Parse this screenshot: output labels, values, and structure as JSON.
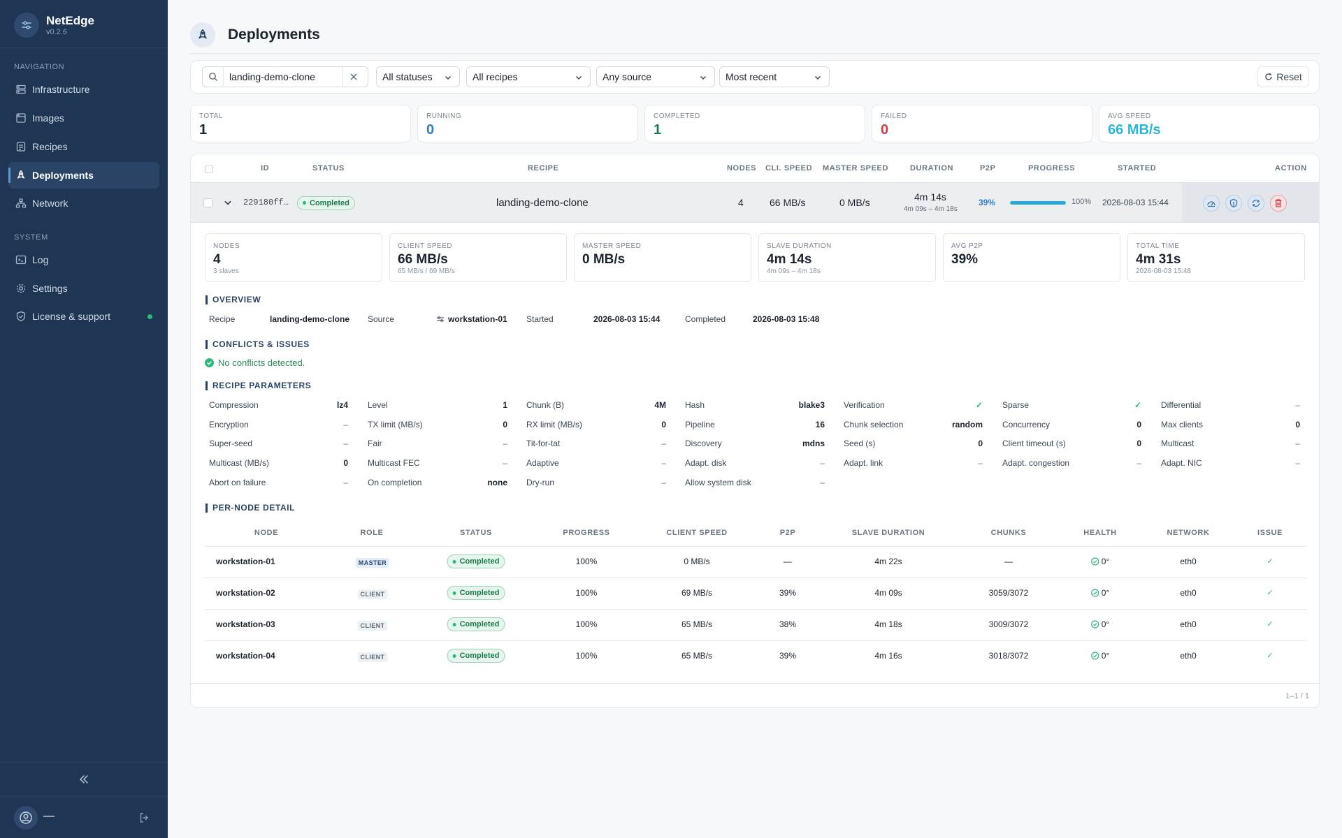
{
  "app": {
    "name": "NetEdge",
    "version": "v0.2.6"
  },
  "sidebar": {
    "sections": {
      "navigation": "NAVIGATION",
      "system": "SYSTEM"
    },
    "nav": [
      {
        "label": "Infrastructure",
        "icon": "server-icon"
      },
      {
        "label": "Images",
        "icon": "disk-icon"
      },
      {
        "label": "Recipes",
        "icon": "recipe-icon"
      },
      {
        "label": "Deployments",
        "icon": "rocket-icon",
        "active": true
      },
      {
        "label": "Network",
        "icon": "network-icon"
      }
    ],
    "system": [
      {
        "label": "Log",
        "icon": "terminal-icon"
      },
      {
        "label": "Settings",
        "icon": "gear-icon"
      },
      {
        "label": "License & support",
        "icon": "shield-icon",
        "status_dot": "#2fb67c"
      }
    ],
    "user": {
      "name": "—"
    }
  },
  "page": {
    "title": "Deployments"
  },
  "filters": {
    "search_value": "landing-demo-clone",
    "status": "All statuses",
    "recipe": "All recipes",
    "source": "Any source",
    "sort": "Most recent",
    "reset_label": "Reset"
  },
  "stats": [
    {
      "label": "TOTAL",
      "value": "1",
      "color": "#1c2430"
    },
    {
      "label": "RUNNING",
      "value": "0",
      "color": "#2f7fc4"
    },
    {
      "label": "COMPLETED",
      "value": "1",
      "color": "#1d7a4b"
    },
    {
      "label": "FAILED",
      "value": "0",
      "color": "#d33a47"
    },
    {
      "label": "AVG SPEED",
      "value": "66 MB/s",
      "color": "#2ab6d8"
    }
  ],
  "table": {
    "headers": {
      "id": "ID",
      "status": "STATUS",
      "recipe": "RECIPE",
      "nodes": "NODES",
      "cli_speed": "CLI. SPEED",
      "master_speed": "MASTER SPEED",
      "duration": "DURATION",
      "p2p": "P2P",
      "progress": "PROGRESS",
      "started": "STARTED",
      "action": "ACTION"
    },
    "row": {
      "id": "229180ff…",
      "status": "Completed",
      "recipe": "landing-demo-clone",
      "nodes": "4",
      "cli_speed": "66 MB/s",
      "master_speed": "0 MB/s",
      "duration": "4m 14s",
      "duration_range": "4m 09s – 4m 18s",
      "p2p": "39%",
      "progress_label": "100%",
      "progress_fraction": 1.0,
      "started": "2026-08-03 15:44"
    }
  },
  "detail": {
    "cards": [
      {
        "label": "NODES",
        "value": "4",
        "sub": "3 slaves"
      },
      {
        "label": "CLIENT SPEED",
        "value": "66 MB/s",
        "sub": "65 MB/s / 69 MB/s"
      },
      {
        "label": "MASTER SPEED",
        "value": "0 MB/s",
        "sub": ""
      },
      {
        "label": "SLAVE DURATION",
        "value": "4m 14s",
        "sub": "4m 09s – 4m 18s"
      },
      {
        "label": "AVG P2P",
        "value": "39%",
        "sub": ""
      },
      {
        "label": "TOTAL TIME",
        "value": "4m 31s",
        "sub": "2026-08-03 15:48"
      }
    ],
    "overview_title": "OVERVIEW",
    "overview": {
      "recipe_label": "Recipe",
      "recipe": "landing-demo-clone",
      "source_label": "Source",
      "source": "workstation-01",
      "started_label": "Started",
      "started": "2026-08-03 15:44",
      "completed_label": "Completed",
      "completed": "2026-08-03 15:48"
    },
    "conflicts_title": "CONFLICTS & ISSUES",
    "conflicts_text": "No conflicts detected.",
    "params_title": "RECIPE PARAMETERS",
    "params": [
      [
        {
          "k": "Compression",
          "v": "lz4"
        },
        {
          "k": "Level",
          "v": "1"
        },
        {
          "k": "Chunk (B)",
          "v": "4M"
        },
        {
          "k": "Hash",
          "v": "blake3"
        },
        {
          "k": "Verification",
          "v": "✓"
        },
        {
          "k": "Sparse",
          "v": "✓"
        },
        {
          "k": "Differential",
          "v": "–"
        }
      ],
      [
        {
          "k": "Encryption",
          "v": "–"
        },
        {
          "k": "TX limit (MB/s)",
          "v": "0"
        },
        {
          "k": "RX limit (MB/s)",
          "v": "0"
        },
        {
          "k": "Pipeline",
          "v": "16"
        },
        {
          "k": "Chunk selection",
          "v": "random"
        },
        {
          "k": "Concurrency",
          "v": "0"
        },
        {
          "k": "Max clients",
          "v": "0"
        }
      ],
      [
        {
          "k": "Super-seed",
          "v": "–"
        },
        {
          "k": "Fair",
          "v": "–"
        },
        {
          "k": "Tit-for-tat",
          "v": "–"
        },
        {
          "k": "Discovery",
          "v": "mdns"
        },
        {
          "k": "Seed (s)",
          "v": "0"
        },
        {
          "k": "Client timeout (s)",
          "v": "0"
        },
        {
          "k": "Multicast",
          "v": "–"
        }
      ],
      [
        {
          "k": "Multicast (MB/s)",
          "v": "0"
        },
        {
          "k": "Multicast FEC",
          "v": "–"
        },
        {
          "k": "Adaptive",
          "v": "–"
        },
        {
          "k": "Adapt. disk",
          "v": "–"
        },
        {
          "k": "Adapt. link",
          "v": "–"
        },
        {
          "k": "Adapt. congestion",
          "v": "–"
        },
        {
          "k": "Adapt. NIC",
          "v": "–"
        }
      ],
      [
        {
          "k": "Abort on failure",
          "v": "–"
        },
        {
          "k": "On completion",
          "v": "none"
        },
        {
          "k": "Dry-run",
          "v": "–"
        },
        {
          "k": "Allow system disk",
          "v": "–"
        }
      ]
    ],
    "pernode_title": "PER-NODE DETAIL",
    "pernode_headers": {
      "node": "NODE",
      "role": "ROLE",
      "status": "STATUS",
      "progress": "PROGRESS",
      "client_speed": "CLIENT SPEED",
      "p2p": "P2P",
      "slave_duration": "SLAVE DURATION",
      "chunks": "CHUNKS",
      "health": "HEALTH",
      "network": "NETWORK",
      "issue": "ISSUE"
    },
    "nodes": [
      {
        "node": "workstation-01",
        "role": "MASTER",
        "status": "Completed",
        "progress": "100%",
        "client_speed": "0 MB/s",
        "p2p": "—",
        "slave_duration": "4m 22s",
        "chunks": "—",
        "health": "0°",
        "network": "eth0",
        "issue": "✓"
      },
      {
        "node": "workstation-02",
        "role": "CLIENT",
        "status": "Completed",
        "progress": "100%",
        "client_speed": "69 MB/s",
        "p2p": "39%",
        "slave_duration": "4m 09s",
        "chunks": "3059/3072",
        "health": "0°",
        "network": "eth0",
        "issue": "✓"
      },
      {
        "node": "workstation-03",
        "role": "CLIENT",
        "status": "Completed",
        "progress": "100%",
        "client_speed": "65 MB/s",
        "p2p": "38%",
        "slave_duration": "4m 18s",
        "chunks": "3009/3072",
        "health": "0°",
        "network": "eth0",
        "issue": "✓"
      },
      {
        "node": "workstation-04",
        "role": "CLIENT",
        "status": "Completed",
        "progress": "100%",
        "client_speed": "65 MB/s",
        "p2p": "39%",
        "slave_duration": "4m 16s",
        "chunks": "3018/3072",
        "health": "0°",
        "network": "eth0",
        "issue": "✓"
      }
    ]
  },
  "pagination": "1–1 / 1"
}
